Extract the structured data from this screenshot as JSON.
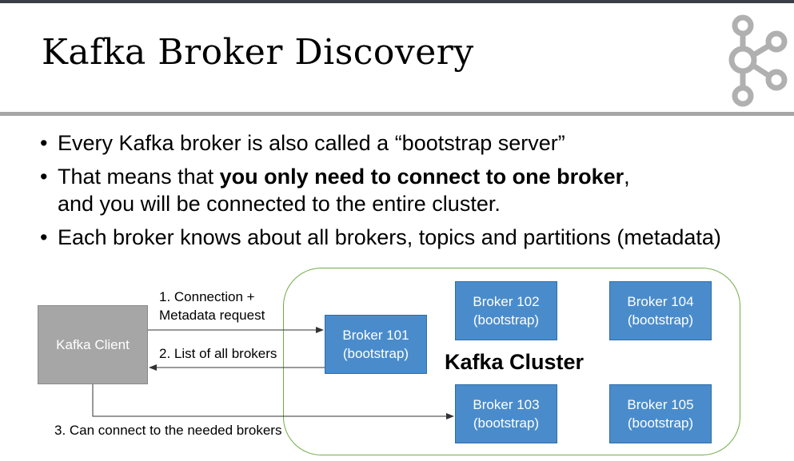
{
  "slide": {
    "title": "Kafka Broker Discovery",
    "bullets": [
      {
        "parts": [
          "Every Kafka broker is also called a “bootstrap server”"
        ]
      },
      {
        "pre": "That means that ",
        "bold": "you only need to connect to one broker",
        "post": ",",
        "line2": "and you will be connected to the entire cluster."
      },
      {
        "parts": [
          "Each broker knows about all brokers, topics and partitions (metadata)"
        ]
      }
    ]
  },
  "diagram": {
    "client_label": "Kafka Client",
    "cluster_label": "Kafka Cluster",
    "brokers": [
      {
        "name": "Broker 101",
        "role": "(bootstrap)"
      },
      {
        "name": "Broker 102",
        "role": "(bootstrap)"
      },
      {
        "name": "Broker 103",
        "role": "(bootstrap)"
      },
      {
        "name": "Broker 104",
        "role": "(bootstrap)"
      },
      {
        "name": "Broker 105",
        "role": "(bootstrap)"
      }
    ],
    "steps": {
      "step1_line1": "1. Connection +",
      "step1_line2": "Metadata request",
      "step2": "2. List of all brokers",
      "step3": "3. Can connect to the needed brokers"
    }
  },
  "colors": {
    "broker_fill": "#4a8ccb",
    "client_fill": "#a6a6a6",
    "cluster_border": "#70ad47",
    "logo_gray": "#b0b0b0"
  }
}
